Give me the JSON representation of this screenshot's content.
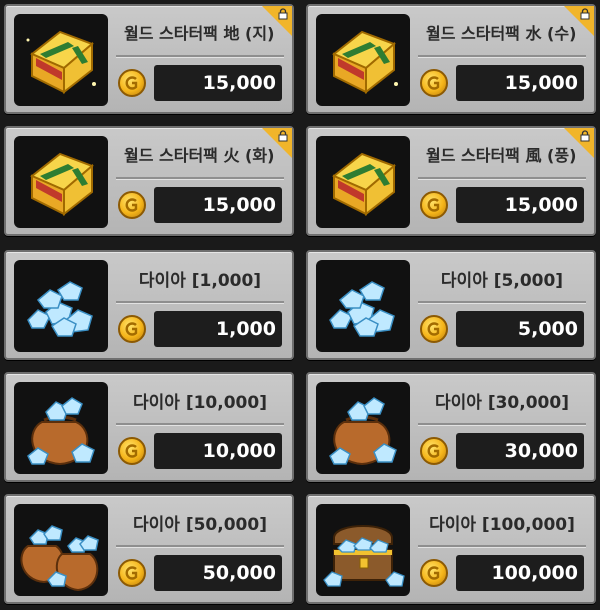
{
  "shop": {
    "items": [
      {
        "title": "월드 스타터팩 地 (지)",
        "price": "15,000",
        "icon": "starter-pack-chest-icon",
        "locked": true
      },
      {
        "title": "월드 스타터팩 水 (수)",
        "price": "15,000",
        "icon": "starter-pack-chest-icon",
        "locked": true
      },
      {
        "title": "월드 스타터팩 火 (화)",
        "price": "15,000",
        "icon": "starter-pack-chest-icon",
        "locked": true
      },
      {
        "title": "월드 스타터팩 風 (풍)",
        "price": "15,000",
        "icon": "starter-pack-chest-icon",
        "locked": true
      },
      {
        "title": "다이아 [1,000]",
        "price": "1,000",
        "icon": "diamond-pile-icon",
        "locked": false
      },
      {
        "title": "다이아 [5,000]",
        "price": "5,000",
        "icon": "diamond-pile-icon",
        "locked": false
      },
      {
        "title": "다이아 [10,000]",
        "price": "10,000",
        "icon": "diamond-sack-icon",
        "locked": false
      },
      {
        "title": "다이아 [30,000]",
        "price": "30,000",
        "icon": "diamond-sack-icon",
        "locked": false
      },
      {
        "title": "다이아 [50,000]",
        "price": "50,000",
        "icon": "diamond-double-sack-icon",
        "locked": false
      },
      {
        "title": "다이아 [100,000]",
        "price": "100,000",
        "icon": "diamond-treasure-chest-icon",
        "locked": false
      }
    ]
  },
  "colors": {
    "corner": "#f1b52a",
    "coin": "#f5b51a",
    "card": "#c2c2c2",
    "price_bg": "#1d1d1d"
  }
}
